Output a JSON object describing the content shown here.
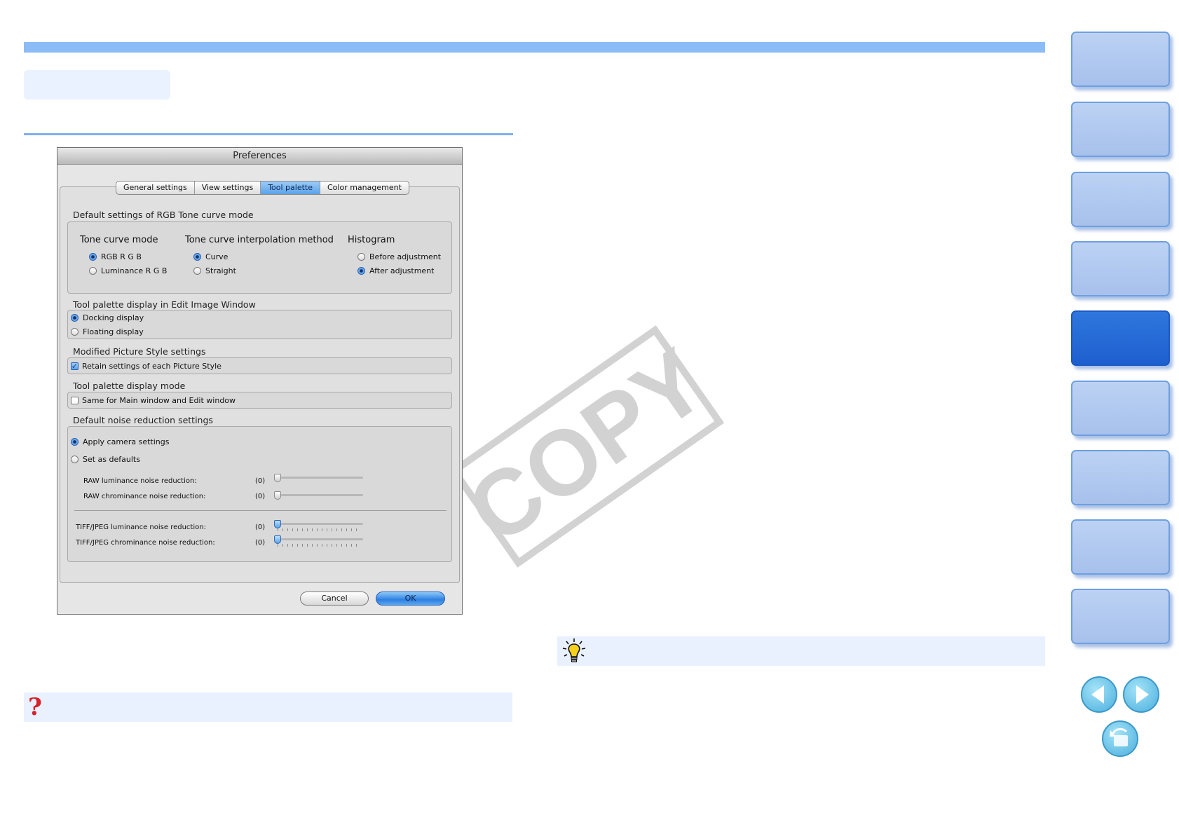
{
  "window": {
    "title": "Preferences",
    "tabs": [
      "General settings",
      "View settings",
      "Tool palette",
      "Color management"
    ],
    "selected_tab": "Tool palette"
  },
  "rgb_tone_curve": {
    "section_label": "Default settings of RGB Tone curve mode",
    "tone_curve_mode": {
      "heading": "Tone curve mode",
      "options": [
        "RGB R G B",
        "Luminance R G B"
      ],
      "selected": "RGB R G B"
    },
    "interpolation": {
      "heading": "Tone curve interpolation method",
      "options": [
        "Curve",
        "Straight"
      ],
      "selected": "Curve"
    },
    "histogram": {
      "heading": "Histogram",
      "options": [
        "Before adjustment",
        "After adjustment"
      ],
      "selected": "After adjustment"
    }
  },
  "palette_display": {
    "section_label": "Tool palette display in Edit Image Window",
    "options": [
      "Docking display",
      "Floating display"
    ],
    "selected": "Docking display"
  },
  "picture_style": {
    "section_label": "Modified Picture Style settings",
    "checkbox_label": "Retain settings of each Picture Style",
    "checked": true
  },
  "display_mode": {
    "section_label": "Tool palette display mode",
    "checkbox_label": "Same for Main window and Edit window",
    "checked": false
  },
  "noise": {
    "section_label": "Default noise reduction settings",
    "options": [
      "Apply camera settings",
      "Set as defaults"
    ],
    "selected": "Apply camera settings",
    "sliders": [
      {
        "label": "RAW luminance noise reduction:",
        "value": "(0)"
      },
      {
        "label": "RAW chrominance noise reduction:",
        "value": "(0)"
      },
      {
        "label": "TIFF/JPEG luminance noise reduction:",
        "value": "(0)"
      },
      {
        "label": "TIFF/JPEG chrominance noise reduction:",
        "value": "(0)"
      }
    ]
  },
  "buttons": {
    "cancel": "Cancel",
    "ok": "OK"
  },
  "watermark": "COPY",
  "icons": {
    "question": "?",
    "tip": "lightbulb-icon"
  },
  "side_nav": {
    "tab_count": 9,
    "active_index": 4
  },
  "colors": {
    "accent": "#8cbcf5",
    "active_tab": "#2a6fd9",
    "panel": "#e8f1fd"
  }
}
